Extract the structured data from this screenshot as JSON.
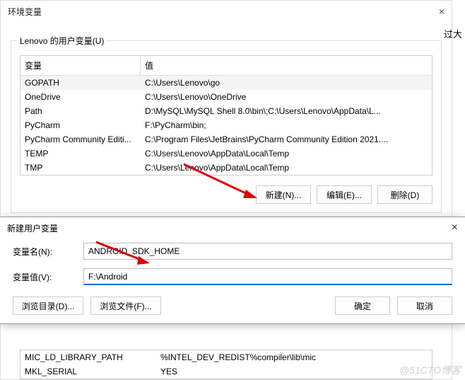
{
  "env_dialog": {
    "title": "环境变量",
    "close": "×",
    "side_text": "过大",
    "group_label": "Lenovo 的用户变量(U)",
    "headers": {
      "name": "变量",
      "value": "值"
    },
    "rows": [
      {
        "name": "GOPATH",
        "value": "C:\\Users\\Lenovo\\go"
      },
      {
        "name": "OneDrive",
        "value": "C:\\Users\\Lenovo\\OneDrive"
      },
      {
        "name": "Path",
        "value": "D:\\MySQL\\MySQL Shell 8.0\\bin\\;C:\\Users\\Lenovo\\AppData\\L..."
      },
      {
        "name": "PyCharm",
        "value": "F:\\PyCharm\\bin;"
      },
      {
        "name": "PyCharm Community Editi...",
        "value": "C:\\Program Files\\JetBrains\\PyCharm Community Edition 2021...."
      },
      {
        "name": "TEMP",
        "value": "C:\\Users\\Lenovo\\AppData\\Local\\Temp"
      },
      {
        "name": "TMP",
        "value": "C:\\Users\\Lenovo\\AppData\\Local\\Temp"
      }
    ],
    "buttons": {
      "new": "新建(N)...",
      "edit": "编辑(E)...",
      "del": "删除(D)"
    }
  },
  "new_var": {
    "title": "新建用户变量",
    "close": "×",
    "name_label": "变量名(N):",
    "name_value": "ANDROID_SDK_HOME",
    "value_label": "变量值(V):",
    "value_value": "F:\\Android",
    "browse_dir": "浏览目录(D)...",
    "browse_file": "浏览文件(F)...",
    "ok": "确定",
    "cancel": "取消"
  },
  "bottom_rows": [
    {
      "name": "MIC_LD_LIBRARY_PATH",
      "value": "%INTEL_DEV_REDIST%compiler\\lib\\mic"
    },
    {
      "name": "MKL_SERIAL",
      "value": "YES"
    }
  ],
  "watermark": "@51CTO博客"
}
